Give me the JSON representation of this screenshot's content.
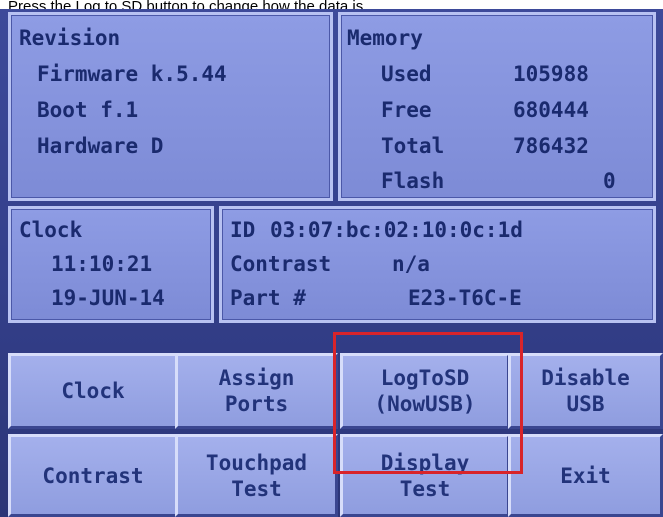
{
  "caption": "Press the Log to SD button to change how the data is",
  "revision": {
    "title": "Revision",
    "lines": [
      "Firmware k.5.44",
      "Boot f.1",
      "Hardware D"
    ]
  },
  "memory": {
    "title": "Memory",
    "rows": [
      {
        "label": "Used",
        "value": "105988"
      },
      {
        "label": "Free",
        "value": "680444"
      },
      {
        "label": "Total",
        "value": "786432"
      },
      {
        "label": "Flash",
        "value": "0"
      }
    ]
  },
  "clock": {
    "title": "Clock",
    "time": "11:10:21",
    "date": "19-JUN-14"
  },
  "info": {
    "id_label": "ID",
    "id_value": "03:07:bc:02:10:0c:1d",
    "contrast_label": "Contrast",
    "contrast_value": "n/a",
    "part_label": "Part #",
    "part_value": "E23-T6C-E"
  },
  "buttons": {
    "clock": [
      "Clock"
    ],
    "assign_ports": [
      "Assign",
      "Ports"
    ],
    "log_to_sd": [
      "LogToSD",
      "(NowUSB)"
    ],
    "disable_usb": [
      "Disable",
      "USB"
    ],
    "contrast": [
      "Contrast"
    ],
    "touchpad_test": [
      "Touchpad",
      "Test"
    ],
    "display_test": [
      "Display",
      "Test"
    ],
    "exit": [
      "Exit"
    ]
  },
  "colors": {
    "highlight": "#d8242a",
    "panel_text": "#1a2a6e",
    "background": "#34408c"
  }
}
